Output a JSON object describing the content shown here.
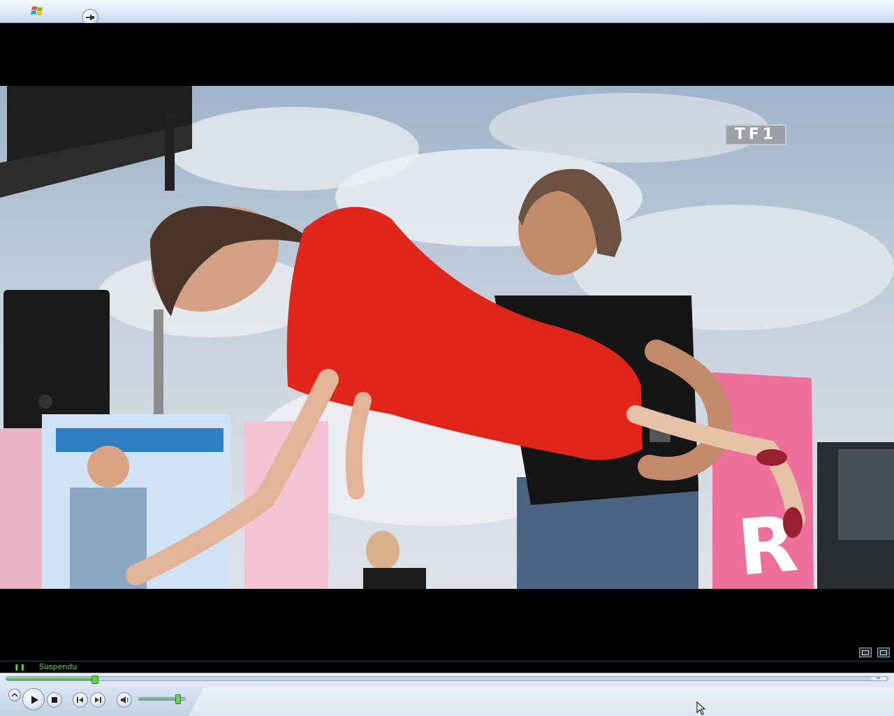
{
  "window": {
    "logo_icon": "windows-flag-icon",
    "pin_icon": "pin-icon"
  },
  "video": {
    "channel_logo": "TF1",
    "scene_icon": "video-frame-image"
  },
  "status": {
    "state_indicator": "❚❚",
    "state_text": "Suspendu"
  },
  "seek": {
    "progress_percent": 10
  },
  "volume": {
    "level_percent": 85
  },
  "icons": {
    "play": "play-icon",
    "stop": "stop-icon",
    "previous": "previous-icon",
    "next": "next-icon",
    "mute": "speaker-icon",
    "switch_view": "switch-view-icon",
    "fullscreen": "fullscreen-icon",
    "close": "close-icon"
  },
  "colors": {
    "accent_green": "#3fae31",
    "status_green": "#48d840"
  }
}
